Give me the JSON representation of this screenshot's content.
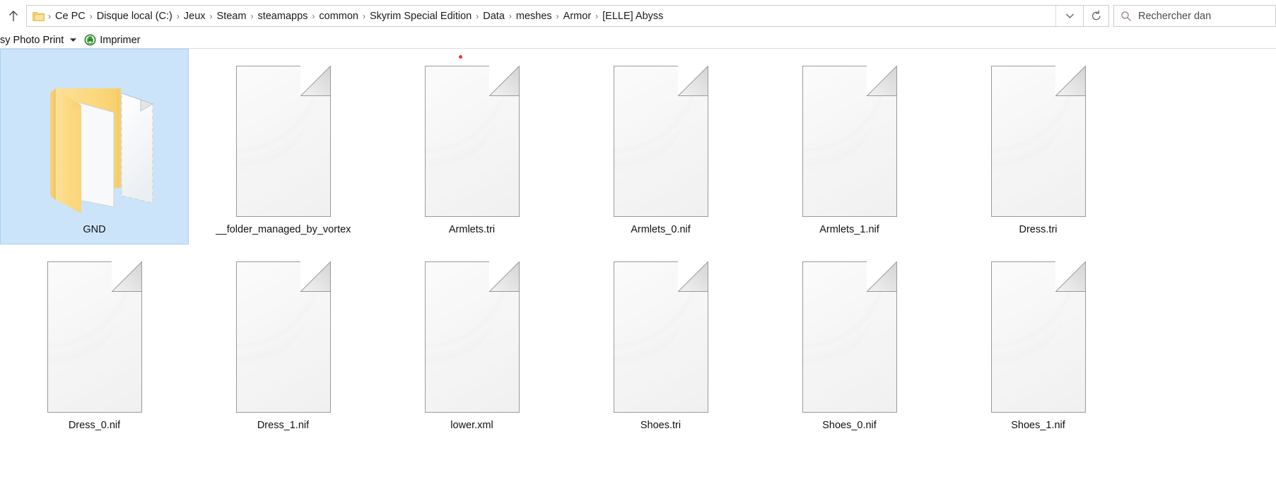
{
  "window": {
    "type": "file-explorer",
    "language": "fr"
  },
  "addressbar": {
    "up_arrow_icon": "arrow-up-icon",
    "folder_icon": "folder-icon",
    "breadcrumbs": [
      "Ce PC",
      "Disque local (C:)",
      "Jeux",
      "Steam",
      "steamapps",
      "common",
      "Skyrim Special Edition",
      "Data",
      "meshes",
      "Armor",
      "[ELLE] Abyss"
    ],
    "separator": "›",
    "dropdown_icon": "chevron-down-icon",
    "refresh_icon": "refresh-icon"
  },
  "search": {
    "icon": "search-icon",
    "placeholder": "Rechercher dan"
  },
  "toolbar": {
    "photo_print_label": "sy Photo Print",
    "caret_icon": "caret-down-icon",
    "printer_icon": "printer-icon",
    "print_label": "Imprimer"
  },
  "files": [
    {
      "name": "GND",
      "icon": "open-folder-icon",
      "type": "folder",
      "selected": true
    },
    {
      "name": "__folder_managed_by_vortex",
      "icon": "generic-file-icon",
      "type": "file",
      "selected": false
    },
    {
      "name": "Armlets.tri",
      "icon": "generic-file-icon",
      "type": "file",
      "selected": false
    },
    {
      "name": "Armlets_0.nif",
      "icon": "generic-file-icon",
      "type": "file",
      "selected": false
    },
    {
      "name": "Armlets_1.nif",
      "icon": "generic-file-icon",
      "type": "file",
      "selected": false
    },
    {
      "name": "Dress.tri",
      "icon": "generic-file-icon",
      "type": "file",
      "selected": false
    },
    {
      "name": "Dress_0.nif",
      "icon": "generic-file-icon",
      "type": "file",
      "selected": false
    },
    {
      "name": "Dress_1.nif",
      "icon": "generic-file-icon",
      "type": "file",
      "selected": false
    },
    {
      "name": "lower.xml",
      "icon": "generic-file-icon",
      "type": "file",
      "selected": false
    },
    {
      "name": "Shoes.tri",
      "icon": "generic-file-icon",
      "type": "file",
      "selected": false
    },
    {
      "name": "Shoes_0.nif",
      "icon": "generic-file-icon",
      "type": "file",
      "selected": false
    },
    {
      "name": "Shoes_1.nif",
      "icon": "generic-file-icon",
      "type": "file",
      "selected": false
    }
  ],
  "colors": {
    "selection_fill": "#cce4fa",
    "selection_border": "#a5d2f5",
    "folder_yellow": "#fcd97f",
    "printer_green": "#2e8b2e",
    "cursor_dot": "#e03a3a"
  }
}
